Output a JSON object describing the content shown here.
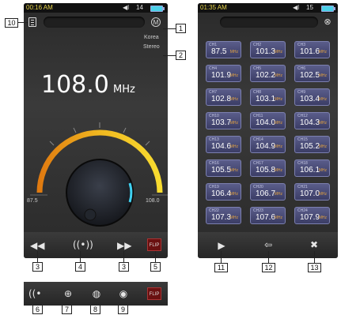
{
  "left_screen": {
    "status_time": "00:16 AM",
    "volume_icon": "speaker-icon",
    "volume_level": "14",
    "mode_button": "M",
    "region": "Korea",
    "audio_mode": "Stereo",
    "frequency": "108.0",
    "frequency_unit": "MHz",
    "dial_min": "87.5",
    "dial_max": "108.0",
    "dial_level_percent": 100,
    "toolbar_buttons": [
      "rewind-icon",
      "scan-icon",
      "fast-forward-icon"
    ],
    "flip_label": "FLIP",
    "alt_toolbar_buttons": [
      "antenna-icon",
      "record-icon",
      "globe-icon",
      "circle-icon"
    ]
  },
  "right_screen": {
    "status_time": "01:35 AM",
    "volume_level": "15",
    "close_button": "⊗",
    "presets": [
      {
        "ch": "CH1",
        "freq": "87.5"
      },
      {
        "ch": "CH2",
        "freq": "101.3"
      },
      {
        "ch": "CH3",
        "freq": "101.6"
      },
      {
        "ch": "CH4",
        "freq": "101.9"
      },
      {
        "ch": "CH5",
        "freq": "102.2"
      },
      {
        "ch": "CH6",
        "freq": "102.5"
      },
      {
        "ch": "CH7",
        "freq": "102.8"
      },
      {
        "ch": "CH8",
        "freq": "103.1"
      },
      {
        "ch": "CH9",
        "freq": "103.4"
      },
      {
        "ch": "CH10",
        "freq": "103.7"
      },
      {
        "ch": "CH11",
        "freq": "104.0"
      },
      {
        "ch": "CH12",
        "freq": "104.3"
      },
      {
        "ch": "CH13",
        "freq": "104.6"
      },
      {
        "ch": "CH14",
        "freq": "104.9"
      },
      {
        "ch": "CH15",
        "freq": "105.2"
      },
      {
        "ch": "CH16",
        "freq": "105.5"
      },
      {
        "ch": "CH17",
        "freq": "105.8"
      },
      {
        "ch": "CH18",
        "freq": "106.1"
      },
      {
        "ch": "CH19",
        "freq": "106.4"
      },
      {
        "ch": "CH20",
        "freq": "106.7"
      },
      {
        "ch": "CH21",
        "freq": "107.0"
      },
      {
        "ch": "CH22",
        "freq": "107.3"
      },
      {
        "ch": "CH23",
        "freq": "107.6"
      },
      {
        "ch": "CH24",
        "freq": "107.9"
      }
    ],
    "preset_unit": "MHz",
    "toolbar_buttons": [
      "play-icon",
      "save-to-preset-icon",
      "delete-icon"
    ]
  },
  "callouts": {
    "c1": "1",
    "c2": "2",
    "c3a": "3",
    "c3b": "3",
    "c4": "4",
    "c5": "5",
    "c6": "6",
    "c7": "7",
    "c8": "8",
    "c9": "9",
    "c10": "10",
    "c11": "11",
    "c12": "12",
    "c13": "13"
  }
}
